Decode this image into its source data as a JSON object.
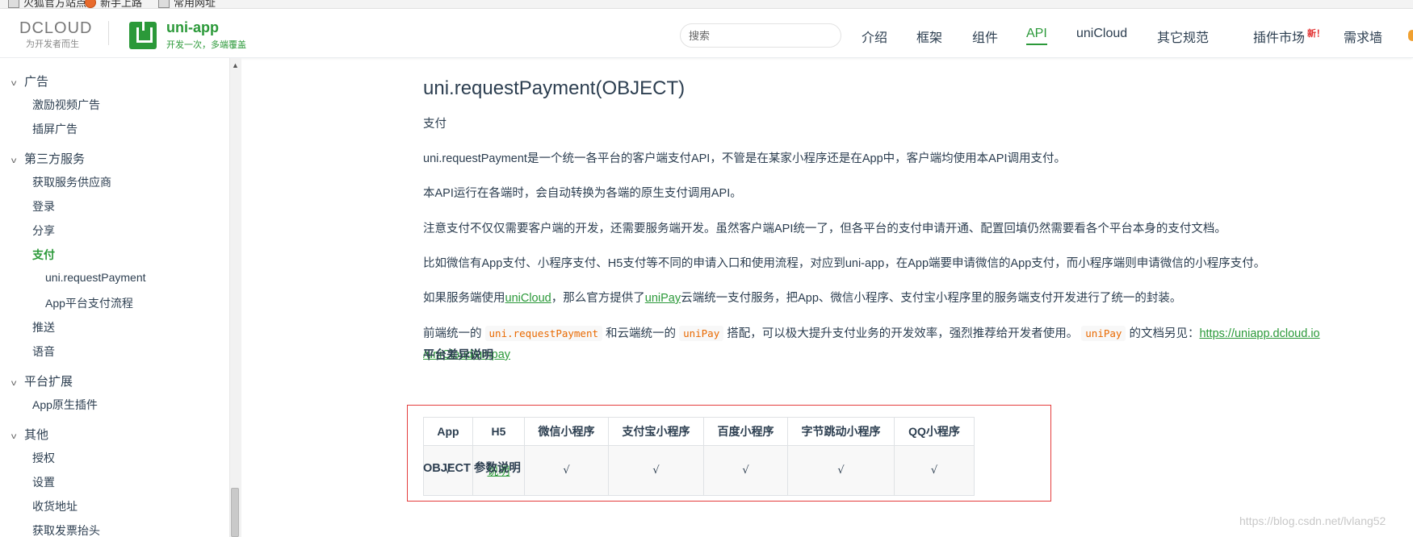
{
  "bookmarks": [
    {
      "label": "火狐官方站点",
      "icon": "folder-icon"
    },
    {
      "label": "新手上路",
      "icon": "firefox-icon"
    },
    {
      "label": "常用网址",
      "icon": "folder-icon"
    }
  ],
  "header": {
    "dcloud_logo": "DCLOUD",
    "dcloud_slogan": "为开发者而生",
    "app_title": "uni-app",
    "app_slogan": "开发一次，多端覆盖",
    "search_placeholder": "搜索",
    "nav": [
      {
        "label": "介绍"
      },
      {
        "label": "框架"
      },
      {
        "label": "组件"
      },
      {
        "label": "API",
        "active": true
      },
      {
        "label": "uniCloud"
      },
      {
        "label": "其它规范"
      },
      {
        "label": "插件市场",
        "badge": "新！"
      },
      {
        "label": "需求墙"
      }
    ],
    "accent_color": "#2b9939"
  },
  "sidebar": {
    "groups": [
      {
        "label": "广告",
        "items": [
          "激励视频广告",
          "插屏广告"
        ]
      },
      {
        "label": "第三方服务",
        "items": [
          "获取服务供应商",
          "登录",
          "分享",
          "支付",
          "uni.requestPayment",
          "App平台支付流程",
          "推送",
          "语音"
        ]
      },
      {
        "label": "平台扩展",
        "items": [
          "App原生插件"
        ]
      },
      {
        "label": "其他",
        "items": [
          "授权",
          "设置",
          "收货地址",
          "获取发票抬头"
        ]
      }
    ],
    "active_item": "支付"
  },
  "content": {
    "title": "uni.requestPayment(OBJECT)",
    "p1": "支付",
    "p2": "uni.requestPayment是一个统一各平台的客户端支付API，不管是在某家小程序还是在App中，客户端均使用本API调用支付。",
    "p3": "本API运行在各端时，会自动转换为各端的原生支付调用API。",
    "p4": "注意支付不仅仅需要客户端的开发，还需要服务端开发。虽然客户端API统一了，但各平台的支付申请开通、配置回填仍然需要看各个平台本身的支付文档。",
    "p5": "比如微信有App支付、小程序支付、H5支付等不同的申请入口和使用流程，对应到uni-app，在App端要申请微信的App支付，而小程序端则申请微信的小程序支付。",
    "p6": {
      "pre": "如果服务端使用",
      "link1": "uniCloud",
      "mid": "，那么官方提供了",
      "link2": "uniPay",
      "post": "云端统一支付服务，把App、微信小程序、支付宝小程序里的服务端支付开发进行了统一的封装。"
    },
    "p7": {
      "a": "前端统一的",
      "code1": "uni.requestPayment",
      "b": "和云端统一的",
      "code2": "uniPay",
      "c": "搭配，可以极大提升支付业务的开发效率，强烈推荐给开发者使用。",
      "code3": "uniPay",
      "d": "的文档另见：",
      "link_line1": "https://uniapp.dcloud.io",
      "link_line2": "/uniCloud/unipay"
    },
    "section_platform": "平台差异说明",
    "table": {
      "headers": [
        "App",
        "H5",
        "微信小程序",
        "支付宝小程序",
        "百度小程序",
        "字节跳动小程序",
        "QQ小程序"
      ],
      "row": [
        "√",
        "说明",
        "√",
        "√",
        "√",
        "√",
        "√"
      ]
    },
    "section_object": "OBJECT 参数说明"
  },
  "watermark": "https://blog.csdn.net/lvlang52"
}
